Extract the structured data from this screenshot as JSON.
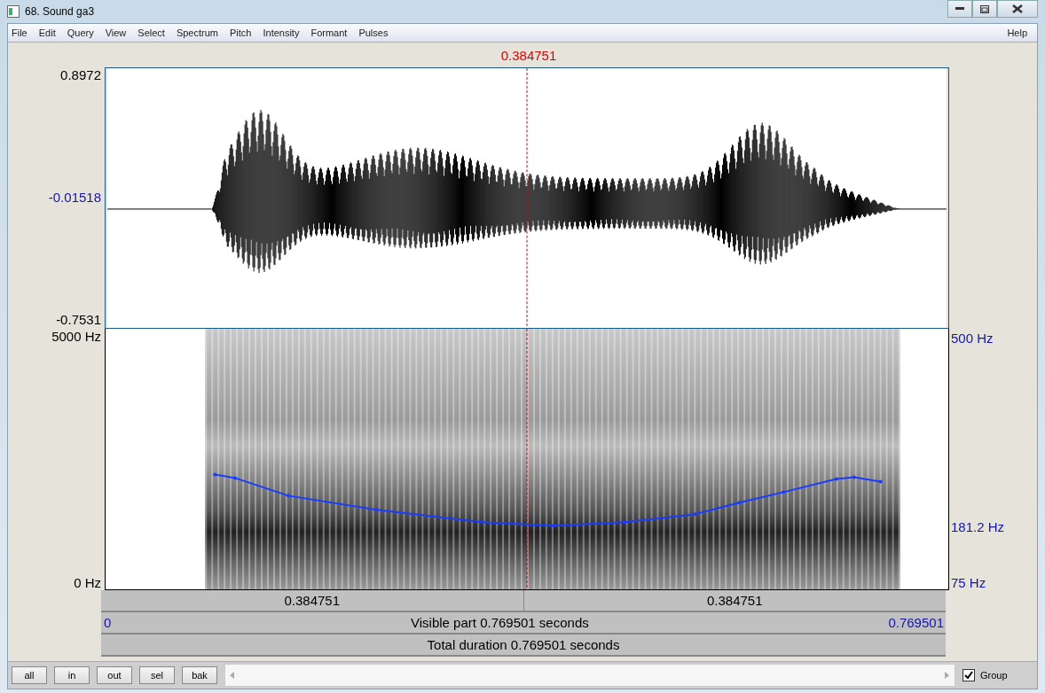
{
  "window": {
    "title": "68. Sound ga3"
  },
  "menu": [
    "File",
    "Edit",
    "Query",
    "View",
    "Select",
    "Spectrum",
    "Pitch",
    "Intensity",
    "Formant",
    "Pulses"
  ],
  "help": "Help",
  "cursor_time": "0.384751",
  "waveform": {
    "y_max": "0.8972",
    "y_mid": "-0.01518",
    "y_min": "-0.7531"
  },
  "spectrogram": {
    "freq_max": "5000 Hz",
    "freq_min": "0 Hz",
    "pitch_max": "500 Hz",
    "pitch_value": "181.2 Hz",
    "pitch_min": "75 Hz"
  },
  "bars": {
    "left_part": "0.384751",
    "right_part": "0.384751",
    "visible_start": "0",
    "visible_label": "Visible part 0.769501 seconds",
    "visible_end": "0.769501",
    "total": "Total duration 0.769501 seconds"
  },
  "buttons": [
    "all",
    "in",
    "out",
    "sel",
    "bak"
  ],
  "group": {
    "label": "Group",
    "checked": true
  }
}
